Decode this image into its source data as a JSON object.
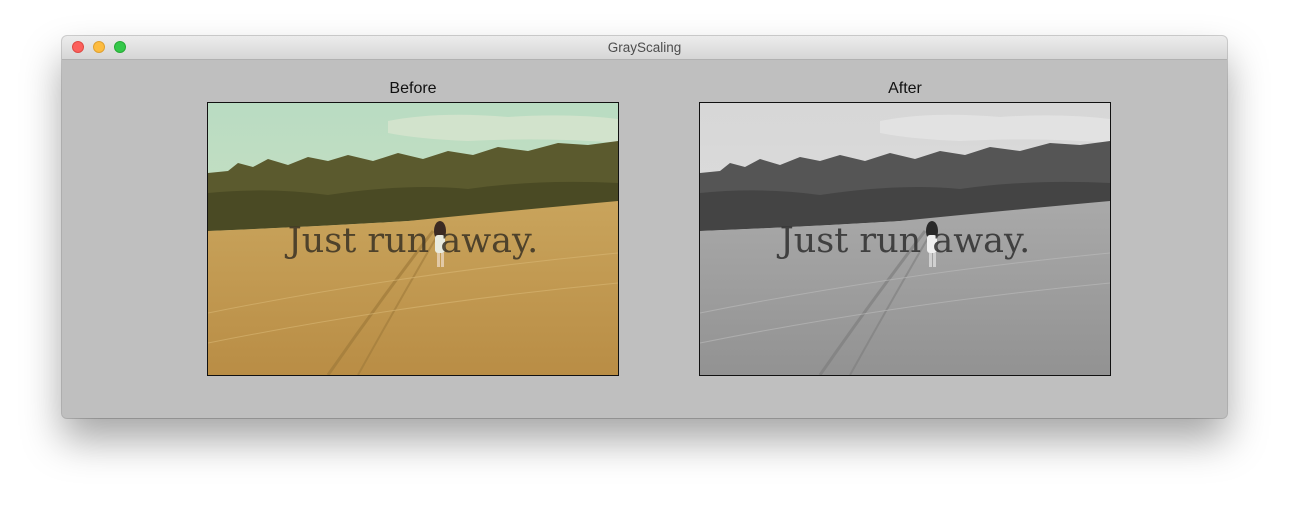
{
  "window": {
    "title": "GrayScaling"
  },
  "panels": {
    "before": {
      "label": "Before",
      "photo_caption": "Just run away."
    },
    "after": {
      "label": "After",
      "photo_caption": "Just run away."
    }
  },
  "colors": {
    "window_background": "#bfbfbf",
    "close": "#fc605c",
    "minimize": "#fdbc40",
    "zoom": "#34c84a"
  }
}
